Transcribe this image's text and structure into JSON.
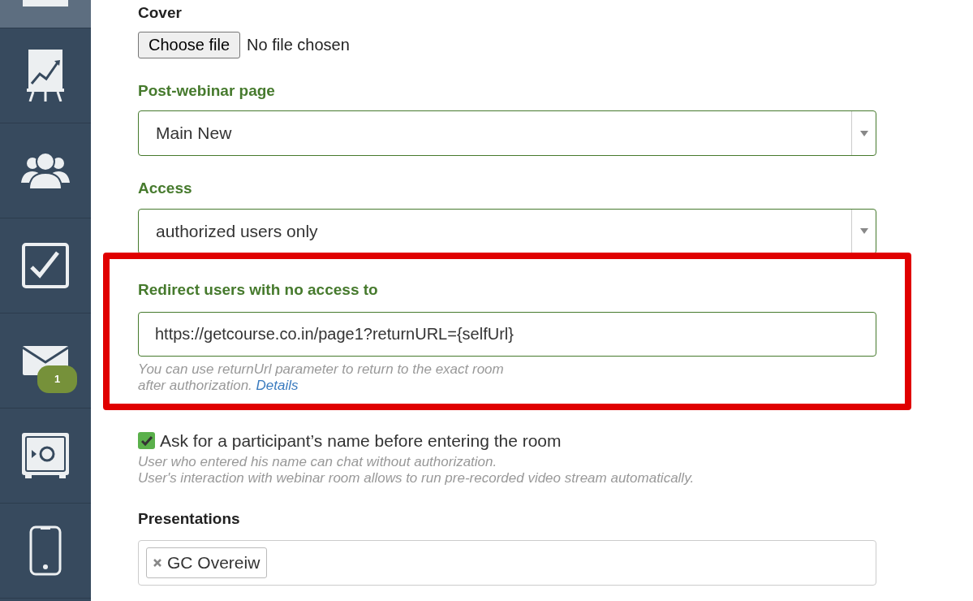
{
  "sidebar": {
    "items": [
      {
        "kind": "page",
        "selected": true
      },
      {
        "kind": "chart",
        "selected": false
      },
      {
        "kind": "people",
        "selected": false
      },
      {
        "kind": "tasks",
        "selected": false
      },
      {
        "kind": "mail",
        "selected": false,
        "badge": "1"
      },
      {
        "kind": "safe",
        "selected": false
      },
      {
        "kind": "phone",
        "selected": false
      }
    ]
  },
  "form": {
    "fields": [
      {
        "kind": "file",
        "label": "Cover",
        "button": "Choose file",
        "status": "No file chosen",
        "highlighted": false
      },
      {
        "kind": "select",
        "label": "Post-webinar page",
        "value": "Main New",
        "highlighted": false
      },
      {
        "kind": "select",
        "label": "Access",
        "value": "authorized users only",
        "highlighted": false
      },
      {
        "kind": "input",
        "label": "Redirect users with no access to",
        "value": "https://getcourse.co.in/page1?returnURL={selfUrl}",
        "hint": "You can use returnUrl parameter to return to the exact room",
        "hint_2": "after authorization.",
        "link": "Details",
        "highlighted": true
      },
      {
        "kind": "checkbox",
        "label": "Ask for a participant’s name before entering the room",
        "checked": true,
        "hint": "User who entered his name can chat without authorization.",
        "hint_2": "User's interaction with webinar room allows to run pre-recorded video stream automatically.",
        "highlighted": false
      },
      {
        "kind": "tags",
        "label": "Presentations",
        "tags": [
          "GC Overeiw"
        ],
        "highlighted": false
      }
    ]
  }
}
